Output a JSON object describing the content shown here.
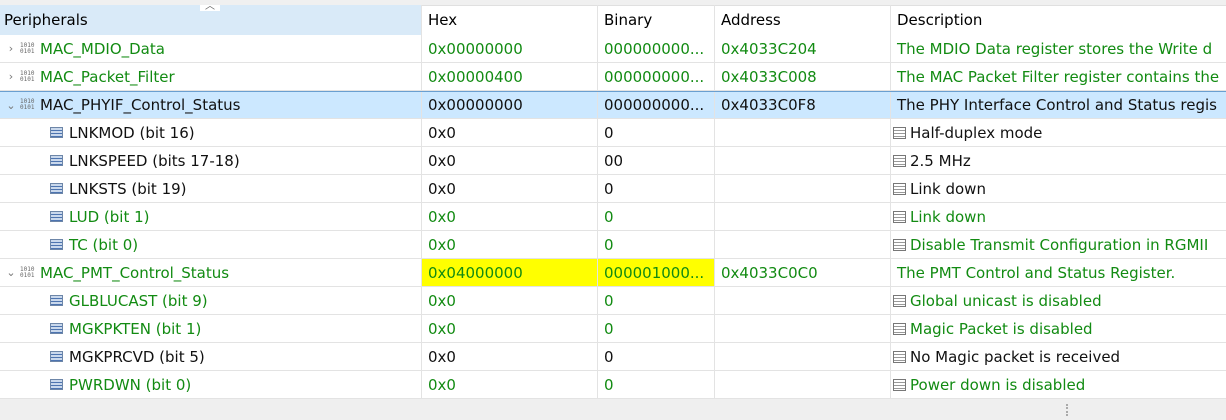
{
  "columns": [
    "Peripherals",
    "Hex",
    "Binary",
    "Address",
    "Description"
  ],
  "rows": [
    {
      "name": "MAC_MDIO_Data",
      "kind": "register",
      "expanded": false,
      "color": "g",
      "hex": "0x00000000",
      "bin": "000000000...",
      "addr": "0x4033C204",
      "desc": "The MDIO Data register stores the Write d"
    },
    {
      "name": "MAC_Packet_Filter",
      "kind": "register",
      "expanded": false,
      "color": "g",
      "hex": "0x00000400",
      "bin": "000000000...",
      "addr": "0x4033C008",
      "desc": "The MAC Packet Filter register contains the"
    },
    {
      "name": "MAC_PHYIF_Control_Status",
      "kind": "register",
      "expanded": true,
      "selected": true,
      "color": "k",
      "hex": "0x00000000",
      "bin": "000000000...",
      "addr": "0x4033C0F8",
      "desc": "The PHY Interface Control and Status regis"
    },
    {
      "name": "LNKMOD (bit 16)",
      "kind": "field",
      "color": "k",
      "hex": "0x0",
      "bin": "0",
      "addr": "",
      "desc": "Half-duplex mode"
    },
    {
      "name": "LNKSPEED (bits 17-18)",
      "kind": "field",
      "color": "k",
      "hex": "0x0",
      "bin": "00",
      "addr": "",
      "desc": "2.5 MHz"
    },
    {
      "name": "LNKSTS (bit 19)",
      "kind": "field",
      "color": "k",
      "hex": "0x0",
      "bin": "0",
      "addr": "",
      "desc": "Link down"
    },
    {
      "name": "LUD (bit 1)",
      "kind": "field",
      "color": "g",
      "hex": "0x0",
      "bin": "0",
      "addr": "",
      "desc": "Link down"
    },
    {
      "name": "TC (bit 0)",
      "kind": "field",
      "color": "g",
      "hex": "0x0",
      "bin": "0",
      "addr": "",
      "desc": "Disable Transmit Configuration in RGMII"
    },
    {
      "name": "MAC_PMT_Control_Status",
      "kind": "register",
      "expanded": true,
      "highlight": true,
      "color": "g",
      "hex": "0x04000000",
      "bin": "000001000...",
      "addr": "0x4033C0C0",
      "desc": "The PMT Control and Status Register."
    },
    {
      "name": "GLBLUCAST (bit 9)",
      "kind": "field",
      "color": "g",
      "hex": "0x0",
      "bin": "0",
      "addr": "",
      "desc": "Global unicast is disabled"
    },
    {
      "name": "MGKPKTEN (bit 1)",
      "kind": "field",
      "color": "g",
      "hex": "0x0",
      "bin": "0",
      "addr": "",
      "desc": "Magic Packet is disabled"
    },
    {
      "name": "MGKPRCVD (bit 5)",
      "kind": "field",
      "color": "k",
      "hex": "0x0",
      "bin": "0",
      "addr": "",
      "desc": "No Magic packet is received"
    },
    {
      "name": "PWRDWN (bit 0)",
      "kind": "field",
      "color": "g",
      "hex": "0x0",
      "bin": "0",
      "addr": "",
      "desc": "Power down is disabled"
    }
  ]
}
